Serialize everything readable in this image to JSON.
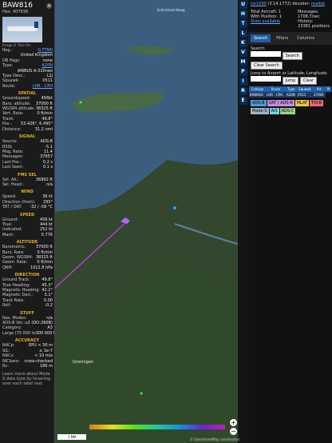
{
  "aircraft": {
    "callsign": "BAW816",
    "hex_line": "Hex: 407938",
    "photo_credit": "Image © Thor Orr"
  },
  "details": [
    {
      "k": "Reg.:",
      "v": "G-TTNN",
      "link": true
    },
    {
      "k": "",
      "v": "United Kingdom"
    },
    {
      "k": "DB flags:",
      "v": "none"
    },
    {
      "k": "Type:",
      "v": "A20N",
      "link": true
    },
    {
      "k": "",
      "v": "AIRBUS A-320neo"
    },
    {
      "k": "Type Desc.:",
      "v": "L2J"
    },
    {
      "k": "Squawk:",
      "v": "0511"
    },
    {
      "k": "Route:",
      "v": "LHR - CPH",
      "link": true
    }
  ],
  "sections": [
    {
      "title": "SPATIAL",
      "rows": [
        [
          "Groundspeed:",
          "456kt"
        ],
        [
          "Baro. altitude:",
          "37000 ft"
        ],
        [
          "WGS84 altitude:",
          "38325 ft"
        ],
        [
          "Vert. Rate:",
          "0 ft/min"
        ],
        [
          "Track:",
          "49.8°"
        ],
        [
          "Pos.:",
          "53.426°, 6.495°"
        ],
        [
          "Distance:",
          "31.2 nmi"
        ]
      ]
    },
    {
      "title": "SIGNAL",
      "rows": [
        [
          "Source:",
          "ADS-B"
        ],
        [
          "RSSI:",
          "-5.1"
        ],
        [
          "Msg. Rate:",
          "11.4"
        ],
        [
          "Messages:",
          "37657"
        ],
        [
          "Last Pos.:",
          "0.2 s"
        ],
        [
          "Last Seen:",
          "0.1 s"
        ]
      ]
    },
    {
      "title": "FMS SEL",
      "rows": [
        [
          "Sel. Alt.:",
          "36992 ft"
        ],
        [
          "Sel. Head.:",
          "n/a"
        ]
      ]
    },
    {
      "title": "WIND",
      "rows": [
        [
          "Speed:",
          "36 kt"
        ],
        [
          "Direction (from):",
          "295°"
        ],
        [
          "TAT / OAT:",
          "-32 / -56 °C"
        ]
      ]
    },
    {
      "title": "SPEED",
      "rows": [
        [
          "Ground:",
          "456 kt"
        ],
        [
          "True:",
          "444 kt"
        ],
        [
          "Indicated:",
          "252 kt"
        ],
        [
          "Mach:",
          "0.776"
        ]
      ]
    },
    {
      "title": "ALTITUDE",
      "rows": [
        [
          "Barometric:",
          "37000 ft"
        ],
        [
          "Baro. Rate:",
          "0 ft/min"
        ],
        [
          "Geom. WGS84:",
          "38325 ft"
        ],
        [
          "Geom. Rate:",
          "0 ft/min"
        ],
        [
          "QNH:",
          "1012.8 hPa"
        ]
      ]
    },
    {
      "title": "DIRECTION",
      "rows": [
        [
          "Ground Track:",
          "49.8°"
        ],
        [
          "True Heading:",
          "45.3°"
        ],
        [
          "Magnetic Heading:",
          "42.2°"
        ],
        [
          "Magnetic Decl.:",
          "3.1°"
        ],
        [
          "Track Rate:",
          "0.00"
        ],
        [
          "Roll:",
          "-0.2"
        ]
      ]
    },
    {
      "title": "STUFF",
      "rows": [
        [
          "Nav. Modes:",
          "n/a"
        ],
        [
          "ADS-B Ver.:",
          "v2 (DO-260B)"
        ],
        [
          "Category:",
          "A3"
        ],
        [
          "Large (75 000 to",
          "300 000 lb)"
        ]
      ]
    },
    {
      "title": "ACCURACY",
      "rows": [
        [
          "NACp:",
          "EPU < 30 m"
        ],
        [
          "SIL:",
          "≤ 1e-7"
        ],
        [
          "NACv:",
          "< 10 m/s"
        ],
        [
          "NICbaro:",
          "cross-checked"
        ],
        [
          "Rc:",
          "186 m"
        ]
      ]
    }
  ],
  "footnote": "Learn more about Mode S data type by hovering over each label text.",
  "controls": [
    "U",
    "H",
    "T",
    "L",
    "K",
    "V",
    "M",
    "P",
    "I",
    "R",
    "E"
  ],
  "map": {
    "place_top": "Schiermonnikoog",
    "place_mid": "Groningen",
    "scale": "1 NM",
    "attribution": "© OpenStreetMap contributors",
    "zoom_in": "+",
    "zoom_out": "−"
  },
  "right": {
    "version_link": "tar1090",
    "version": "(3.14.1772)",
    "decoder": "decoder:",
    "decoder_link": "readsb",
    "total_label": "Total Aircraft:",
    "total": "1",
    "msgs_label": "Messages:",
    "msgs": "1708.7/sec",
    "withpos_label": "With Position:",
    "withpos": "1",
    "history_label": "History:",
    "history": "23381 positions",
    "stats_label": "Stats available",
    "tabs": [
      "Search",
      "Filters",
      "Columns"
    ],
    "search_label": "Search:",
    "search_btn": "Search",
    "clear_search": "Clear Search",
    "jump_label": "Jump to Airport or Latitude, Longitude:",
    "jump_btn": "Jump",
    "clear_btn": "Clear",
    "cols": [
      "Callsign",
      "Route",
      "Type",
      "Squawk",
      "Alt.",
      "Pt"
    ],
    "row": [
      "BAW816",
      "LHR - CPH",
      "A20N",
      "0511",
      "37000"
    ],
    "badges": [
      {
        "t": "ADS-B",
        "c": "#4d9bd6"
      },
      {
        "t": "UAT / ADS-R",
        "c": "#c58be0"
      },
      {
        "t": "MLAT",
        "c": "#e9c64e"
      },
      {
        "t": "TIS-B",
        "c": "#e86a6a"
      },
      {
        "t": "Mode-S",
        "c": "#a7b3c6"
      },
      {
        "t": "AIS",
        "c": "#7fd3e0"
      },
      {
        "t": "ADS-C",
        "c": "#9ad28a"
      }
    ]
  }
}
